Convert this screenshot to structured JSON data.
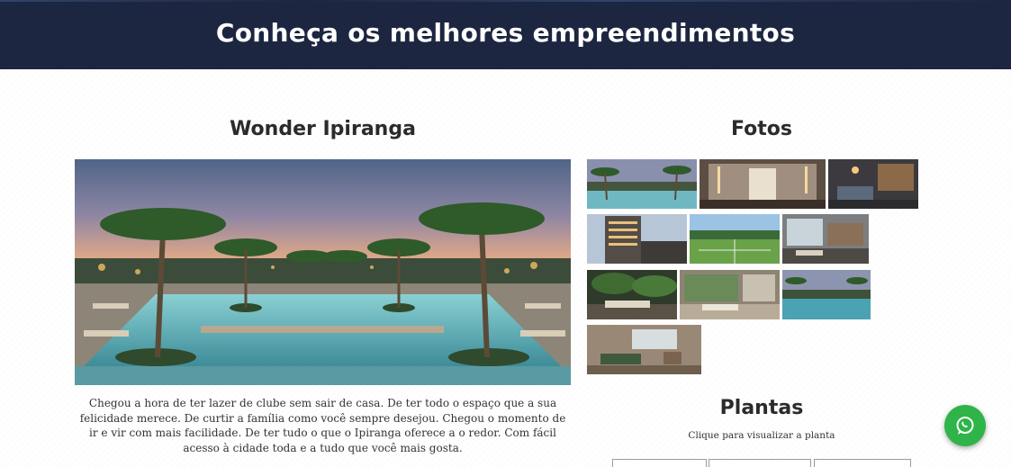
{
  "hero": {
    "title": "Conheça os melhores empreendimentos"
  },
  "project": {
    "title": "Wonder Ipiranga",
    "description": "Chegou a hora de ter lazer de clube sem sair de casa. De ter todo o espaço que a sua felicidade merece. De curtir a família como você sempre desejou. Chegou o momento de ir e vir com mais facilidade. De ter tudo o que o Ipiranga oferece a o redor. Com fácil acesso à cidade toda e a tudo que você mais gosta."
  },
  "fotos": {
    "title": "Fotos",
    "thumbnails": [
      {
        "subject": "pool"
      },
      {
        "subject": "lobby"
      },
      {
        "subject": "lounge"
      },
      {
        "subject": "building"
      },
      {
        "subject": "sports-court"
      },
      {
        "subject": "gourmet"
      },
      {
        "subject": "garden"
      },
      {
        "subject": "living"
      },
      {
        "subject": "pool-night"
      },
      {
        "subject": "game-room"
      }
    ]
  },
  "plantas": {
    "title": "Plantas",
    "subtitle": "Clique para visualizar a planta"
  },
  "whatsapp": {
    "icon": "whatsapp-icon",
    "color": "#2fb449"
  },
  "colors": {
    "header_bg": "#1c2640",
    "accent": "#2fb449"
  }
}
